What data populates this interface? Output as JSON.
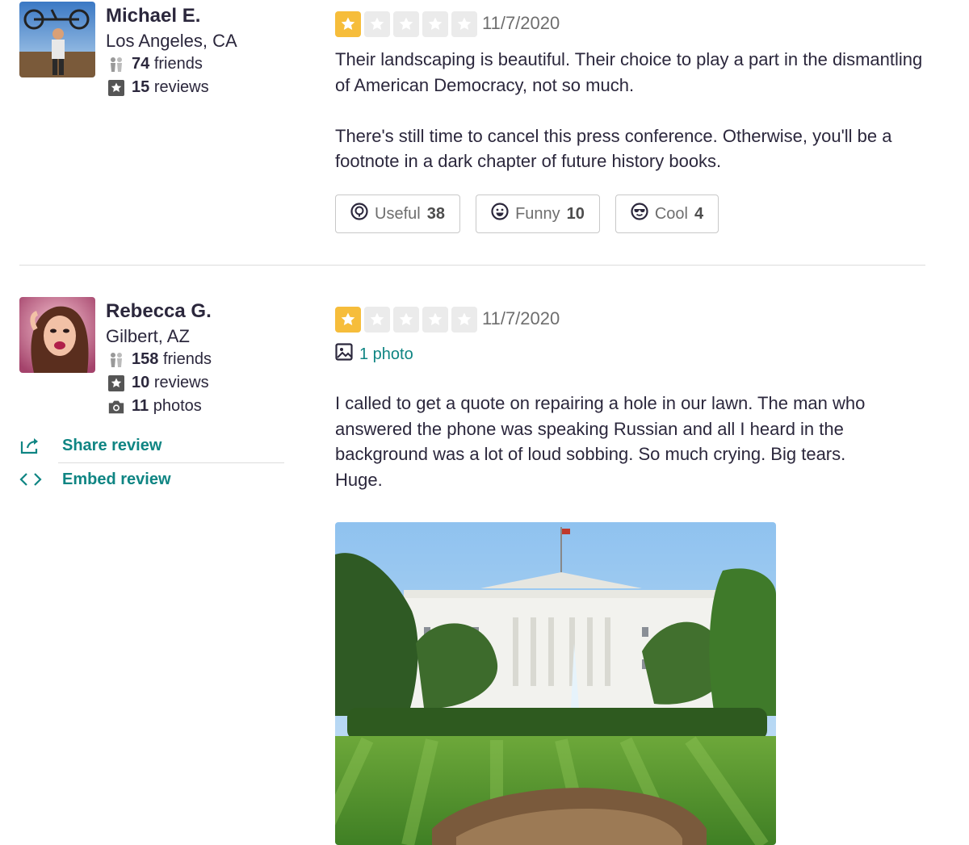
{
  "reviews": [
    {
      "user": {
        "name": "Michael E.",
        "location": "Los Angeles, CA",
        "friends_count": "74",
        "friends_label": "friends",
        "reviews_count": "15",
        "reviews_label": "reviews"
      },
      "rating": 1,
      "date": "11/7/2020",
      "paragraphs": [
        "Their landscaping is beautiful. Their choice to play a part in the dismantling of American Democracy, not so much.",
        "There's still time to cancel this press conference. Otherwise, you'll be a footnote in a dark chapter of future history books."
      ],
      "votes": [
        {
          "label": "Useful",
          "count": "38",
          "icon": "useful-icon"
        },
        {
          "label": "Funny",
          "count": "10",
          "icon": "funny-icon"
        },
        {
          "label": "Cool",
          "count": "4",
          "icon": "cool-icon"
        }
      ]
    },
    {
      "user": {
        "name": "Rebecca G.",
        "location": "Gilbert, AZ",
        "friends_count": "158",
        "friends_label": "friends",
        "reviews_count": "10",
        "reviews_label": "reviews",
        "photos_count": "11",
        "photos_label": "photos"
      },
      "rating": 1,
      "date": "11/7/2020",
      "photo_link": "1 photo",
      "paragraphs": [
        "I called to get a quote on repairing a hole in our lawn.  The man who answered the phone was speaking Russian and all I heard in the background was a lot of loud sobbing.  So much crying.  Big tears.  Huge."
      ],
      "actions": {
        "share": "Share review",
        "embed": "Embed review"
      }
    }
  ],
  "colors": {
    "star_on": "#f6bd3b",
    "star_off": "#ebebeb",
    "link": "#0f8583",
    "text": "#2b273c"
  }
}
